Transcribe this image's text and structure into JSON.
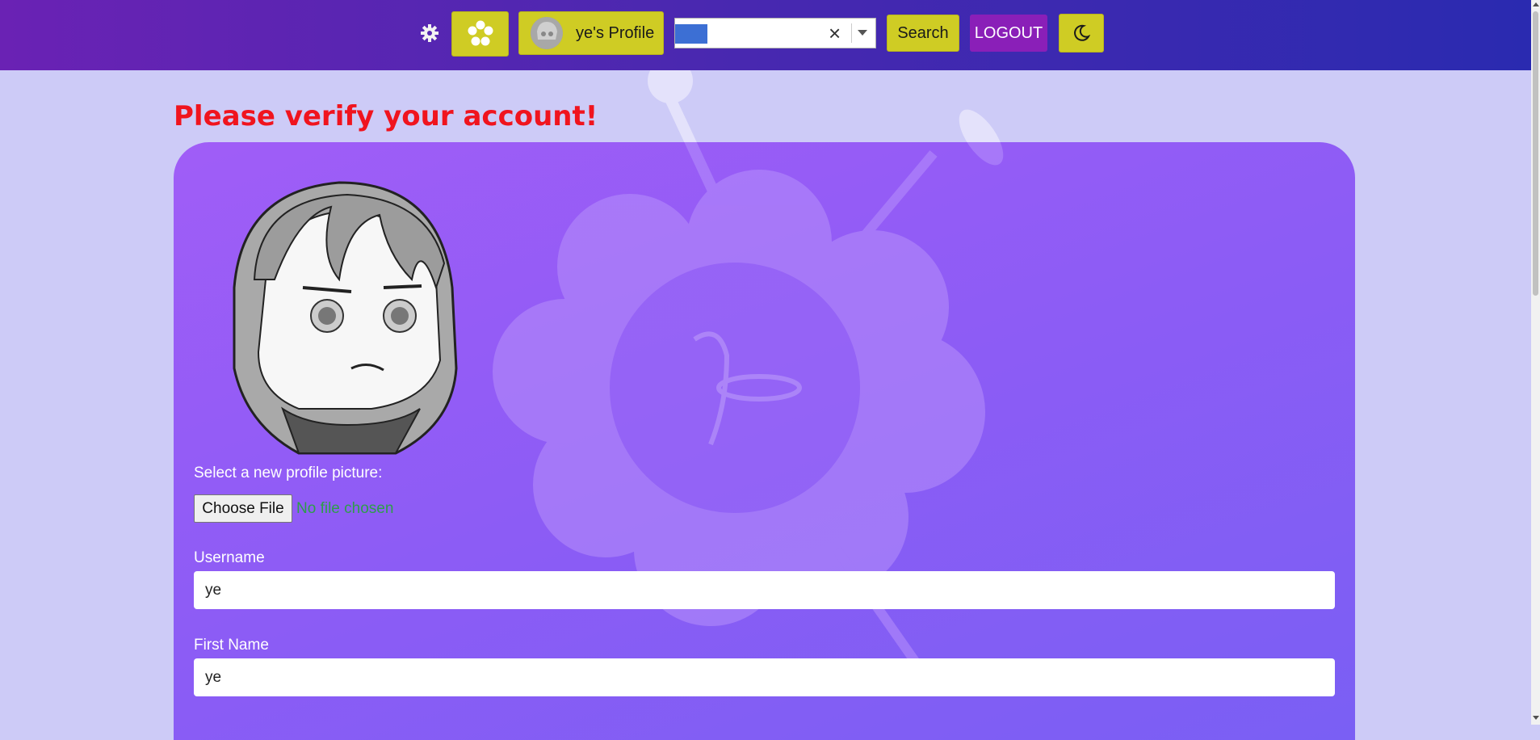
{
  "navbar": {
    "settings_icon": "gear-icon",
    "home_icon": "flower-icon",
    "profile_label": "ye's Profile",
    "search": {
      "value": "",
      "placeholder": ""
    },
    "search_label": "Search",
    "logout_label": "LOGOUT",
    "theme_icon": "moon-icon"
  },
  "page": {
    "alert": "Please verify your account!"
  },
  "profile_form": {
    "picture_label": "Select a new profile picture:",
    "file_button": "Choose File",
    "file_status": "No file chosen",
    "username_label": "Username",
    "username_value": "ye",
    "first_name_label": "First Name",
    "first_name_value": "ye"
  },
  "colors": {
    "accent_yellow": "#cfcc24",
    "logout_purple": "#8a1fb8",
    "alert_red": "#f0141e",
    "card_purple": "#8c5cf5",
    "page_bg": "#cdcbf7"
  }
}
